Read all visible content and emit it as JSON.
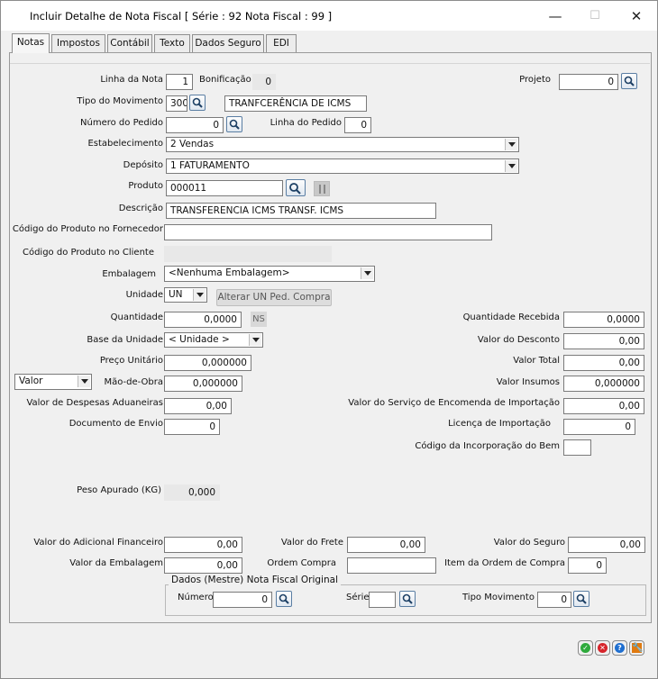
{
  "window": {
    "title": "Incluir Detalhe de Nota Fiscal [ Série : 92 Nota Fiscal : 99 ]",
    "minimize": "—",
    "maximize": "☐",
    "close": "✕"
  },
  "tabs": [
    "Notas",
    "Impostos",
    "Contábil",
    "Texto",
    "Dados Seguro",
    "EDI"
  ],
  "form": {
    "linha_nota": {
      "label": "Linha da Nota",
      "value": "1"
    },
    "bonificacao": {
      "label": "Bonificação",
      "value": "0"
    },
    "projeto": {
      "label": "Projeto",
      "value": "0"
    },
    "tipo_movimento": {
      "label": "Tipo do Movimento",
      "value": "300",
      "desc": "TRANFCERÊNCIA DE ICMS"
    },
    "numero_pedido": {
      "label": "Número do Pedido",
      "value": "0"
    },
    "linha_pedido": {
      "label": "Linha do Pedido",
      "value": "0"
    },
    "estabelecimento": {
      "label": "Estabelecimento",
      "value": "2 Vendas"
    },
    "deposito": {
      "label": "Depósito",
      "value": "1 FATURAMENTO"
    },
    "produto": {
      "label": "Produto",
      "value": "000011"
    },
    "descricao": {
      "label": "Descrição",
      "value": "TRANSFERENCIA ICMS TRANSF. ICMS"
    },
    "cod_fornecedor": {
      "label": "Código do Produto no Fornecedor",
      "value": ""
    },
    "cod_cliente": {
      "label": "Código do Produto no Cliente",
      "value": ""
    },
    "embalagem": {
      "label": "Embalagem",
      "value": "<Nenhuma Embalagem>"
    },
    "unidade": {
      "label": "Unidade",
      "value": "UN",
      "button": "Alterar UN Ped. Compra"
    },
    "quantidade": {
      "label": "Quantidade",
      "value": "0,0000",
      "ns": "NS"
    },
    "qtd_recebida": {
      "label": "Quantidade Recebida",
      "value": "0,0000"
    },
    "base_unidade": {
      "label": "Base da Unidade",
      "value": "< Unidade >"
    },
    "valor_desconto": {
      "label": "Valor do Desconto",
      "value": "0,00"
    },
    "preco_unitario": {
      "label": "Preço Unitário",
      "value": "0,000000"
    },
    "valor_total": {
      "label": "Valor Total",
      "value": "0,00"
    },
    "mao_obra": {
      "label": "Mão-de-Obra",
      "value": "0,000000",
      "mode": "Valor"
    },
    "valor_insumos": {
      "label": "Valor Insumos",
      "value": "0,000000"
    },
    "despesas_aduaneiras": {
      "label": "Valor de Despesas Aduaneiras",
      "value": "0,00"
    },
    "servico_encomenda": {
      "label": "Valor do Serviço de Encomenda de Importação",
      "value": "0,00"
    },
    "documento_envio": {
      "label": "Documento de Envio",
      "value": "0"
    },
    "licenca_importacao": {
      "label": "Licença de Importação",
      "value": "0"
    },
    "codigo_incorporacao": {
      "label": "Código da Incorporação do Bem",
      "value": ""
    },
    "peso_apurado": {
      "label": "Peso Apurado (KG)",
      "value": "0,000"
    },
    "adicional_financeiro": {
      "label": "Valor do Adicional Financeiro",
      "value": "0,00"
    },
    "valor_frete": {
      "label": "Valor do Frete",
      "value": "0,00"
    },
    "valor_seguro": {
      "label": "Valor do Seguro",
      "value": "0,00"
    },
    "valor_embalagem": {
      "label": "Valor da Embalagem",
      "value": "0,00"
    },
    "ordem_compra": {
      "label": "Ordem Compra",
      "value": ""
    },
    "item_ordem_compra": {
      "label": "Item da Ordem de Compra",
      "value": "0"
    }
  },
  "nf_original": {
    "title": "Dados (Mestre) Nota Fiscal Original",
    "numero": {
      "label": "Número",
      "value": "0"
    },
    "serie": {
      "label": "Série",
      "value": ""
    },
    "tipo_movimento": {
      "label": "Tipo Movimento",
      "value": "0"
    }
  },
  "colors": {
    "ok": "#2eaa3c",
    "cancel": "#d6242b",
    "help": "#1f6fd0",
    "tools": "#e07a10"
  }
}
